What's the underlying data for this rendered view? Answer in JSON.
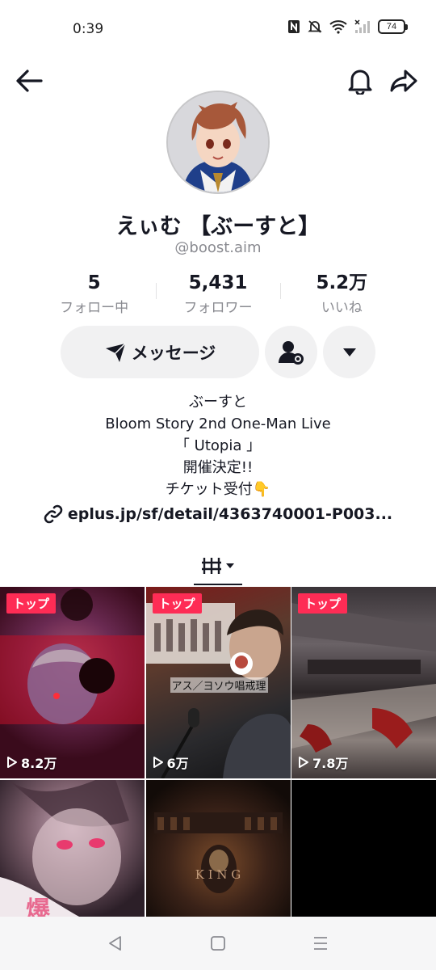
{
  "status_bar": {
    "time": "0:39",
    "battery": "74"
  },
  "profile": {
    "display_name": "えぃむ 【ぶーすと】",
    "username": "@boost.aim",
    "stats": [
      {
        "value": "5",
        "label": "フォロー中"
      },
      {
        "value": "5,431",
        "label": "フォロワー"
      },
      {
        "value": "5.2万",
        "label": "いいね"
      }
    ]
  },
  "actions": {
    "message_label": "メッセージ"
  },
  "bio": {
    "lines": [
      "ぶーすと",
      "Bloom Story 2nd One-Man Live",
      "「 Utopia 」",
      "開催決定!!",
      "チケット受付👇"
    ],
    "link": "eplus.jp/sf/detail/4363740001-P003..."
  },
  "videos": [
    {
      "badge": "トップ",
      "views": "8.2万"
    },
    {
      "badge": "トップ",
      "views": "6万",
      "caption": "アス／ヨソウ唱戒理"
    },
    {
      "badge": "トップ",
      "views": "7.8万"
    },
    {
      "caption": "爆"
    },
    {
      "caption": "K I N G"
    },
    {}
  ],
  "colors": {
    "accent": "#fe2c55",
    "text": "#161823",
    "muted": "#8a8b91",
    "button_bg": "#f1f1f2"
  }
}
